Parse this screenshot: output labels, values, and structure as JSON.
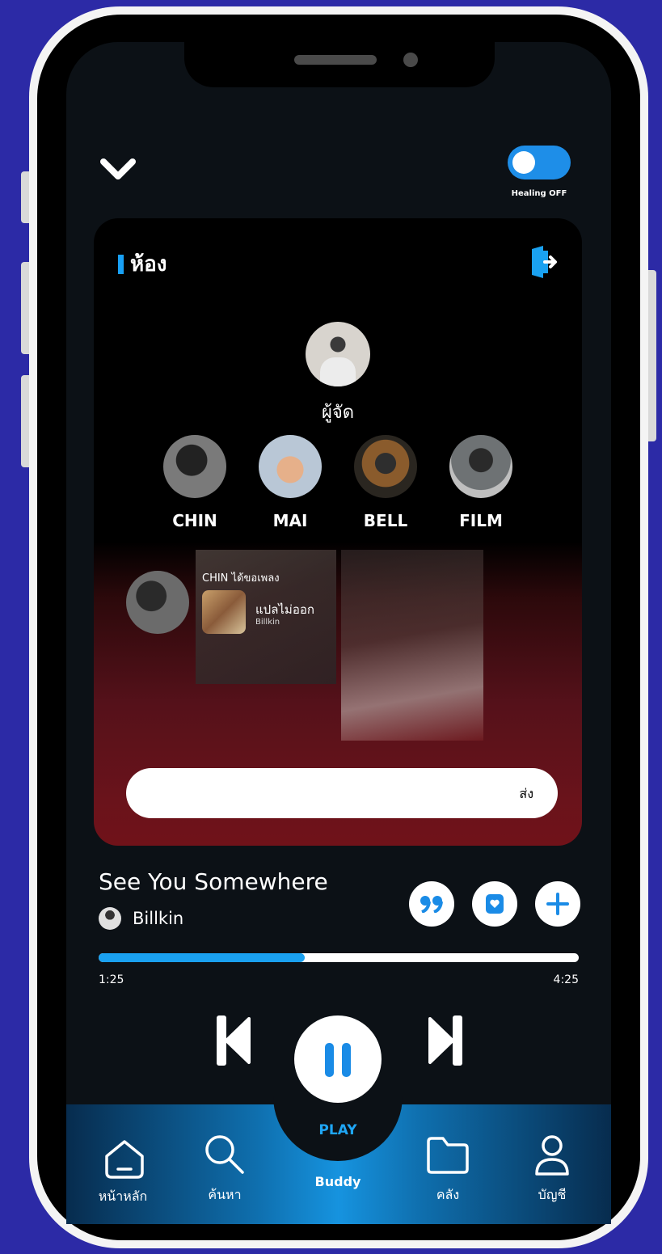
{
  "header": {
    "healing_toggle": {
      "label": "Healing OFF",
      "state": "off"
    }
  },
  "room": {
    "title": "ห้อง",
    "host_label": "ผู้จัด",
    "members": [
      {
        "name": "CHIN"
      },
      {
        "name": "MAI"
      },
      {
        "name": "BELL"
      },
      {
        "name": "FILM"
      }
    ],
    "request": {
      "text": "CHIN ได้ขอเพลง",
      "song": "แปลไม่ออก",
      "artist": "Billkin"
    },
    "message_input": {
      "placeholder": "",
      "send_label": "ส่ง"
    }
  },
  "player": {
    "song_title": "See You Somewhere",
    "artist": "Billkin",
    "current_time": "1:25",
    "total_time": "4:25",
    "progress": 0.43
  },
  "nav": {
    "items": [
      {
        "label": "หน้าหลัก",
        "icon": "home-icon"
      },
      {
        "label": "ค้นหา",
        "icon": "search-icon"
      },
      {
        "label": "Buddy",
        "icon": "buddy-icon"
      },
      {
        "label": "คลัง",
        "icon": "folder-icon"
      },
      {
        "label": "บัญชี",
        "icon": "account-icon"
      }
    ],
    "play_label": "PLAY"
  },
  "colors": {
    "accent": "#1aa1f0",
    "background": "#2c2aa6",
    "screen": "#0c1116"
  }
}
